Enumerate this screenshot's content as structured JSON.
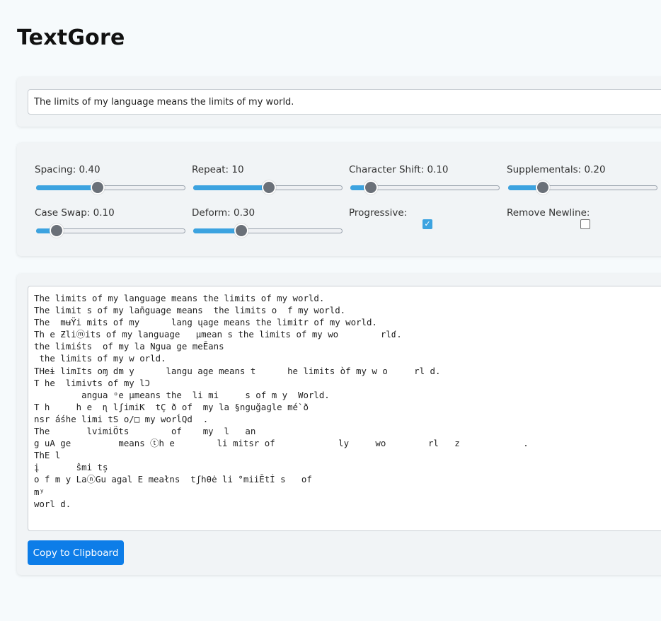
{
  "app": {
    "title": "TextGore"
  },
  "input": {
    "value": "The limits of my language means the limits of my world."
  },
  "controls": {
    "spacing": {
      "label": "Spacing: 0.40",
      "value": 0.4,
      "min": 0,
      "max": 1
    },
    "repeat": {
      "label": "Repeat: 10",
      "value": 10,
      "min": 1,
      "max": 19
    },
    "character_shift": {
      "label": "Character Shift: 0.10",
      "value": 0.1,
      "min": 0,
      "max": 1
    },
    "supplementals": {
      "label": "Supplementals: 0.20",
      "value": 0.2,
      "min": 0,
      "max": 1
    },
    "case_swap": {
      "label": "Case Swap: 0.10",
      "value": 0.1,
      "min": 0,
      "max": 1
    },
    "deform": {
      "label": "Deform: 0.30",
      "value": 0.3,
      "min": 0,
      "max": 1
    },
    "progressive": {
      "label": "Progressive:",
      "checked": true
    },
    "remove_newline": {
      "label": "Remove Newline:",
      "checked": false
    }
  },
  "output": {
    "text": "The limits of my language means the limits of my world.\nThe limit s of my lan̄guage means  the limits o  f my world.\nThe  mʉŸi mits of my      lang ųage means the limitr of my world.\nTh e Ƶliⓜits of my language   µmean s the limits of my wo        rlɗ.\nthe limiśts  of my la Ngua ge meĒans\n the limits of my w orld.\nTHeɨ limIts oɱ dm y      langu age means t      he limits òf my w o     rl d.\nT he  limivts of my lƆ\n         angua ᵒe µmeans the  li mi     s of m y  World.\nT h     h e  ɳ lʃimiƘ  tÇ ð of  my la §nguğaɡle mé`ð\nnsr áśhe limi tS o/□ my worĺQd  .\nThe       lvimiÖts        of    my  l   an\ng uA ge         means ⓣh e        li mitsr of            ly     wo        rl   z            .\nThE l\nį       ŝmi tș\no f m y LaⓝGu agal E meałns  tʃhθė li °miiĒtÍ s   of\nmʸ\nworl d.",
    "copy_label": "Copy to Clipboard"
  },
  "colors": {
    "accent": "#3ca3e0",
    "button": "#0d7de8",
    "thumb": "#6a7078",
    "background": "#f6fafc",
    "card": "#f1f4f6"
  }
}
